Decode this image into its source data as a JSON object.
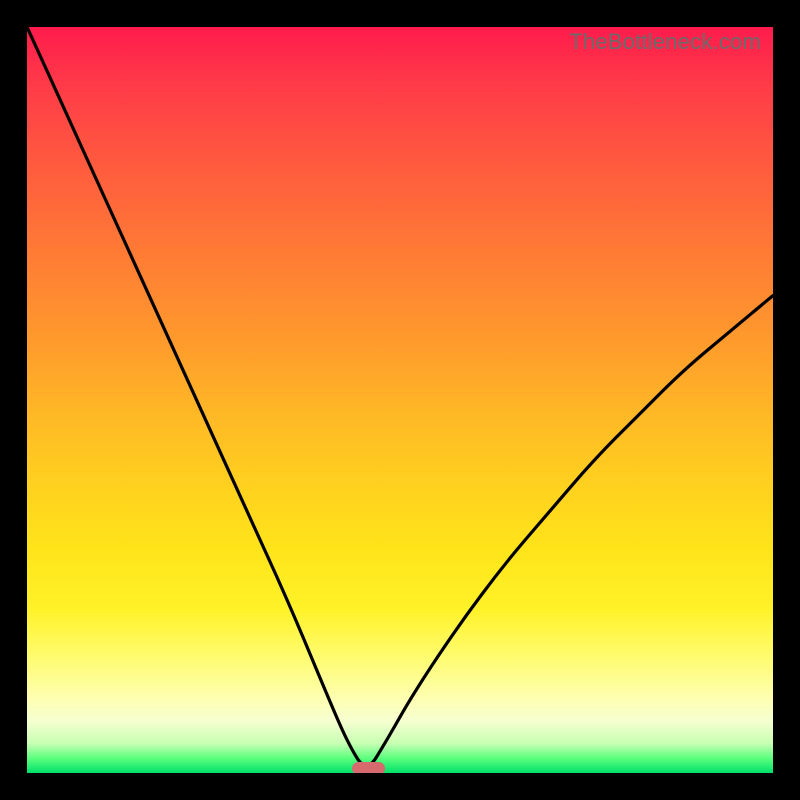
{
  "watermark": "TheBottleneck.com",
  "chart_data": {
    "type": "line",
    "title": "",
    "xlabel": "",
    "ylabel": "",
    "xlim": [
      0,
      100
    ],
    "ylim": [
      0,
      100
    ],
    "grid": false,
    "legend": false,
    "background_gradient": {
      "top_color": "#ff1b4c",
      "bottom_color": "#00e06a",
      "meaning": "red = high bottleneck, green = low bottleneck"
    },
    "optimal_x": 45.5,
    "marker": {
      "x_start": 43.5,
      "x_end": 48.0,
      "color": "#d66a6d"
    },
    "series": [
      {
        "name": "bottleneck-curve",
        "x": [
          0,
          5,
          10,
          15,
          20,
          25,
          30,
          35,
          40,
          43,
          45.5,
          48,
          52,
          58,
          64,
          70,
          76,
          82,
          88,
          94,
          100
        ],
        "values": [
          100,
          89,
          78,
          67,
          56,
          45,
          34,
          23,
          11,
          4,
          0,
          4,
          11,
          20,
          28,
          35,
          42,
          48,
          54,
          59,
          64
        ]
      }
    ]
  },
  "colors": {
    "curve_stroke": "#000000",
    "frame_border": "#000000",
    "marker_fill": "#d66a6d"
  }
}
